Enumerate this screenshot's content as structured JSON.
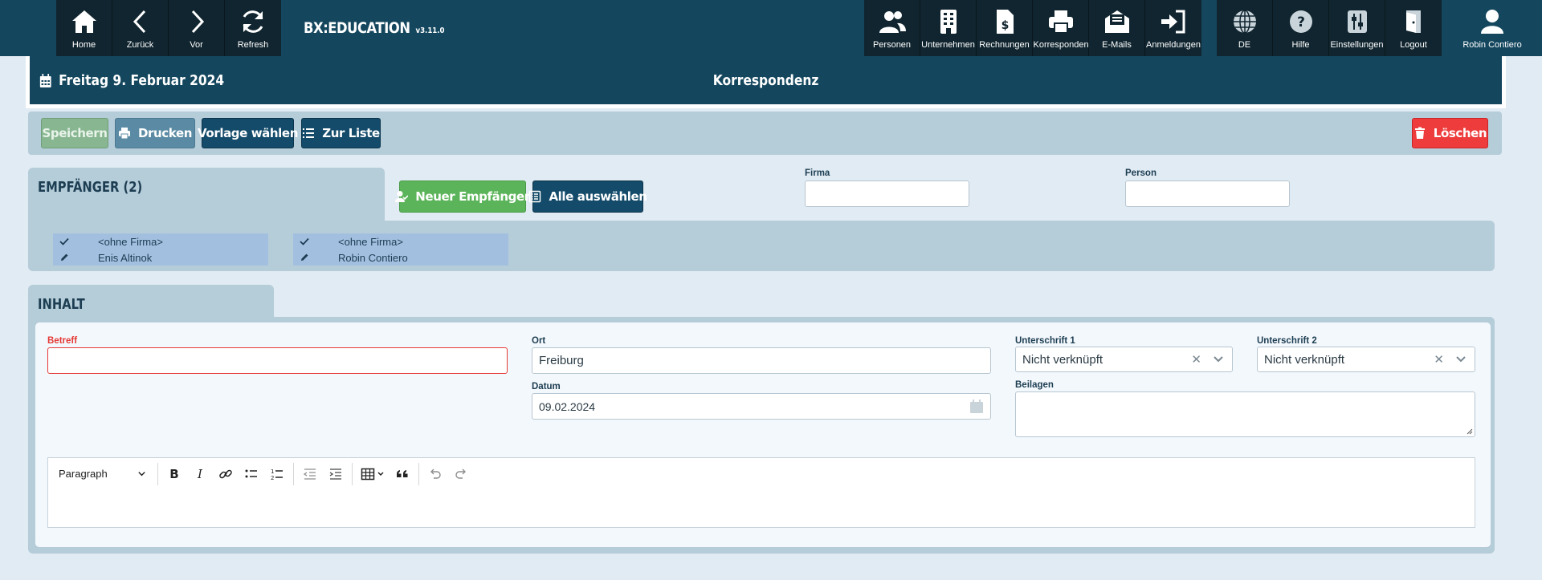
{
  "app": {
    "name": "BX:EDUCATION",
    "version": "v3.11.0"
  },
  "nav_left": [
    {
      "label": "Home",
      "icon": "home-icon"
    },
    {
      "label": "Zurück",
      "icon": "chevron-left-icon"
    },
    {
      "label": "Vor",
      "icon": "chevron-right-icon"
    },
    {
      "label": "Refresh",
      "icon": "refresh-icon"
    }
  ],
  "nav_right": [
    {
      "label": "Personen",
      "icon": "users-icon"
    },
    {
      "label": "Unternehmen",
      "icon": "building-icon"
    },
    {
      "label": "Rechnungen",
      "icon": "invoice-icon"
    },
    {
      "label": "Korrespondenz",
      "icon": "printer-icon"
    },
    {
      "label": "E-Mails",
      "icon": "mail-icon"
    },
    {
      "label": "Anmeldungen",
      "icon": "sign-in-icon"
    }
  ],
  "nav_util": [
    {
      "label": "DE",
      "icon": "globe-icon"
    },
    {
      "label": "Hilfe",
      "icon": "help-icon"
    },
    {
      "label": "Einstellungen",
      "icon": "sliders-icon"
    },
    {
      "label": "Logout",
      "icon": "door-icon"
    }
  ],
  "user": {
    "name": "Robin Contiero",
    "icon": "user-icon"
  },
  "header": {
    "date": "Freitag 9. Februar 2024",
    "title": "Korrespondenz"
  },
  "toolbar": {
    "save": "Speichern",
    "print": "Drucken",
    "template": "Vorlage wählen",
    "list": "Zur Liste",
    "delete": "Löschen"
  },
  "recipients": {
    "heading": "EMPFÄNGER (2)",
    "new_button": "Neuer Empfänger",
    "select_all_button": "Alle auswählen",
    "company_label": "Firma",
    "company_value": "",
    "person_label": "Person",
    "person_value": "",
    "items": [
      {
        "company": "<ohne Firma>",
        "person": "Enis Altinok"
      },
      {
        "company": "<ohne Firma>",
        "person": "Robin Contiero"
      }
    ]
  },
  "content": {
    "heading": "INHALT",
    "subject_label": "Betreff",
    "subject_value": "",
    "place_label": "Ort",
    "place_value": "Freiburg",
    "date_label": "Datum",
    "date_value": "09.02.2024",
    "sig1_label": "Unterschrift 1",
    "sig1_value": "Nicht verknüpft",
    "sig2_label": "Unterschrift 2",
    "sig2_value": "Nicht verknüpft",
    "attachments_label": "Beilagen",
    "attachments_value": "",
    "editor_format": "Paragraph",
    "editor_body": ""
  }
}
